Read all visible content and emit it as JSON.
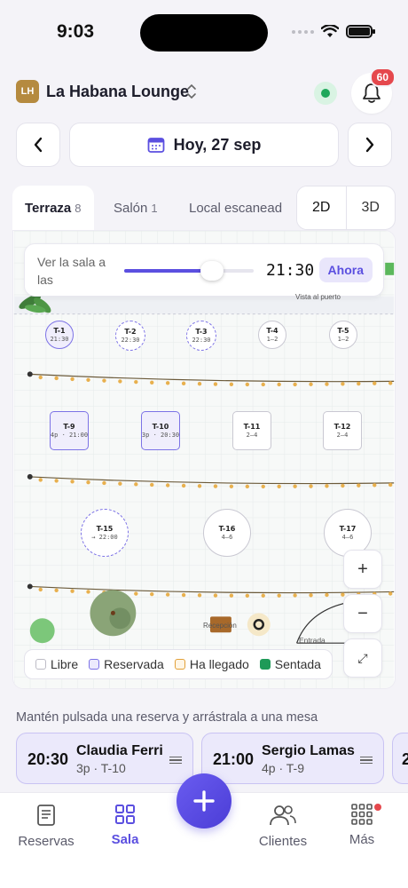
{
  "status_bar": {
    "time": "9:03"
  },
  "header": {
    "venue_initials": "LH",
    "venue_name": "La Habana Lounge",
    "notification_count": "60"
  },
  "date_nav": {
    "label": "Hoy, 27 sep"
  },
  "room_tabs": [
    {
      "label": "Terraza",
      "count": "8"
    },
    {
      "label": "Salón",
      "count": "1"
    },
    {
      "label": "Local escanead",
      "count": ""
    }
  ],
  "view_modes": [
    "2D",
    "3D"
  ],
  "time_card": {
    "label": "Ver la sala a las",
    "value": "21:30",
    "now_label": "Ahora",
    "slider_fraction": 0.68
  },
  "map": {
    "top_banner": "Vista al puerto",
    "reception_label": "Recepción",
    "entrance_label": "Entrada",
    "tables": [
      {
        "name": "T-1",
        "sub": "21:30"
      },
      {
        "name": "T-2",
        "sub": "22:30"
      },
      {
        "name": "T-3",
        "sub": "22:30"
      },
      {
        "name": "T-4",
        "sub": "1–2"
      },
      {
        "name": "T-5",
        "sub": "1–2"
      },
      {
        "name": "T-9",
        "sub": "4p · 21:00"
      },
      {
        "name": "T-10",
        "sub": "3p · 20:30"
      },
      {
        "name": "T-11",
        "sub": "2–4"
      },
      {
        "name": "T-12",
        "sub": "2–4"
      },
      {
        "name": "T-15",
        "sub": "→ 22:00"
      },
      {
        "name": "T-16",
        "sub": "4–6"
      },
      {
        "name": "T-17",
        "sub": "4–6"
      }
    ],
    "zoom_in": "+",
    "zoom_out": "−",
    "fit": "⤢"
  },
  "legend": [
    {
      "label": "Libre",
      "color": "#ffffff",
      "border": "#bdbcc6"
    },
    {
      "label": "Reservada",
      "color": "#eceafd",
      "border": "#7c72e6"
    },
    {
      "label": "Ha llegado",
      "color": "#fff6e6",
      "border": "#e2a038"
    },
    {
      "label": "Sentada",
      "color": "#1f9a58",
      "border": "#1f9a58"
    }
  ],
  "hint": "Mantén pulsada una reserva y arrástrala a una mesa",
  "reservations": [
    {
      "time": "20:30",
      "name": "Claudia Ferri",
      "detail": "3p · T-10"
    },
    {
      "time": "21:00",
      "name": "Sergio Lamas",
      "detail": "4p · T-9"
    },
    {
      "time": "2",
      "name": "",
      "detail": ""
    }
  ],
  "bottom_nav": [
    {
      "label": "Reservas",
      "icon": "list-icon"
    },
    {
      "label": "Sala",
      "icon": "grid-icon"
    },
    {
      "label": "Clientes",
      "icon": "users-icon"
    },
    {
      "label": "Más",
      "icon": "apps-icon"
    }
  ],
  "colors": {
    "accent": "#5b4fe0",
    "online": "#1fa85b",
    "badge": "#e5484d",
    "venue_avatar": "#b58a3f"
  }
}
